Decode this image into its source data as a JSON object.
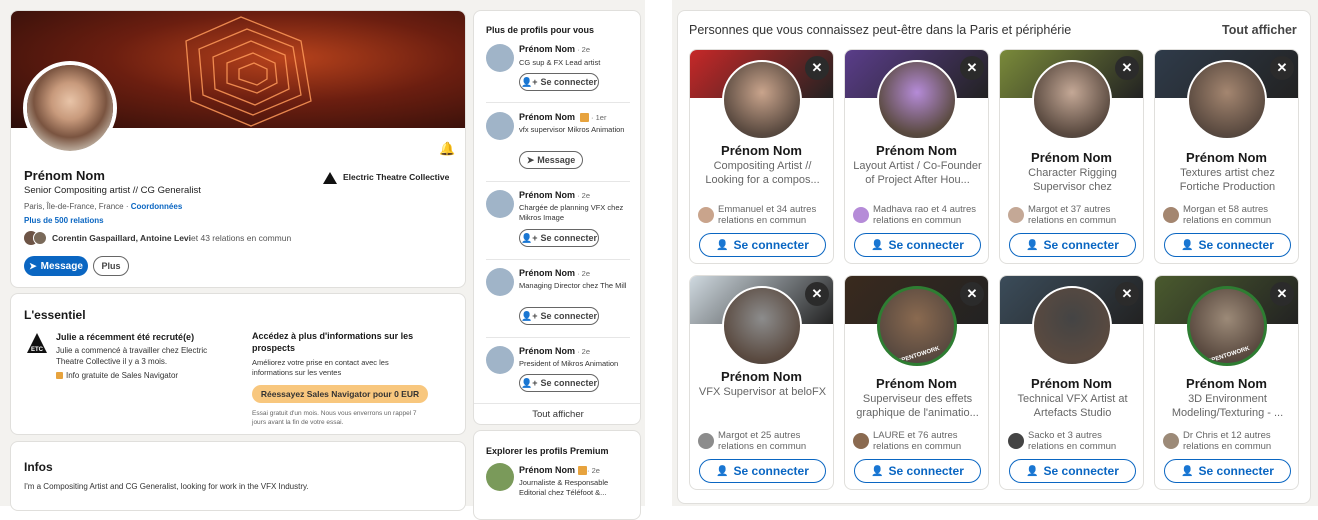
{
  "profile": {
    "name": "Prénom Nom",
    "headline": "Senior Compositing artist // CG Generalist",
    "location": "Paris, Île-de-France, France",
    "location_sep": " · ",
    "contact_link": "Coordonnées",
    "connections": "Plus de 500 relations",
    "mutual_names": "Corentin Gaspaillard, Antoine Levi",
    "mutual_rest": " et 43 relations en commun",
    "company": "Electric Theatre Collective",
    "company_logo": "ETC",
    "message_btn": "Message",
    "more_btn": "Plus"
  },
  "essentials": {
    "title": "L'essentiel",
    "hired_title": "Julie a récemment été recruté(e)",
    "hired_desc": "Julie a commencé à travailler chez Electric Theatre Collective il y a 3 mois.",
    "sales_info": "Info gratuite de Sales Navigator",
    "access_title": "Accédez à plus d'informations sur les prospects",
    "access_desc": "Améliorez votre prise en contact avec les informations sur les ventes",
    "retry_btn": "Réessayez Sales Navigator pour 0 EUR",
    "trial_note": "Essai gratuit d'un mois. Nous vous enverrons un rappel 7 jours avant la fin de votre essai."
  },
  "about": {
    "title": "Infos",
    "text": "I'm a Compositing Artist and CG Generalist, looking for work in the VFX Industry."
  },
  "more_profiles": {
    "title": "Plus de profils pour vous",
    "items": [
      {
        "name": "Prénom Nom",
        "degree": " · 2e",
        "headline": "CG sup & FX Lead artist",
        "btn": "Se connecter",
        "linkedin_badge": false
      },
      {
        "name": "Prénom Nom",
        "degree": " · 1er",
        "headline": "vfx supervisor Mikros Animation",
        "btn": "Message",
        "linkedin_badge": true
      },
      {
        "name": "Prénom Nom",
        "degree": " · 2e",
        "headline": "Chargée de planning VFX chez Mikros Image",
        "btn": "Se connecter",
        "linkedin_badge": false
      },
      {
        "name": "Prénom Nom",
        "degree": " · 2e",
        "headline": "Managing Director chez The Mill",
        "btn": "Se connecter",
        "linkedin_badge": false
      },
      {
        "name": "Prénom Nom",
        "degree": " · 2e",
        "headline": "President of Mikros Animation",
        "btn": "Se connecter",
        "linkedin_badge": false
      }
    ],
    "show_all": "Tout afficher"
  },
  "premium": {
    "title": "Explorer les profils Premium",
    "name": "Prénom Nom",
    "degree": " · 2e",
    "headline": "Journaliste & Responsable Editorial chez Téléfoot &..."
  },
  "pymk": {
    "title": "Personnes que vous connaissez peut-être dans la Paris et périphérie",
    "show_all": "Tout afficher",
    "connect_label": "Se connecter",
    "close_glyph": "✕",
    "cards": [
      {
        "name": "Prénom Nom",
        "headline": "Compositing Artist // Looking for a compos...",
        "mutual": "Emmanuel et 34 autres relations en commun",
        "cover": "#c62828",
        "avatar": "#c9a48c"
      },
      {
        "name": "Prénom Nom",
        "headline": "Layout Artist / Co-Founder of Project After Hou...",
        "mutual": "Madhava rao et 4 autres relations en commun",
        "cover": "#5a3d8a",
        "avatar": "#b58bd8"
      },
      {
        "name": "Prénom Nom",
        "headline": "Character Rigging Supervisor chez Illumination ...",
        "mutual": "Margot et 37 autres relations en commun",
        "cover": "#7a8a3a",
        "avatar": "#c4a896"
      },
      {
        "name": "Prénom Nom",
        "headline": "Textures artist chez Fortiche Production",
        "mutual": "Morgan et 58 autres relations en commun",
        "cover": "#2f3b4a",
        "avatar": "#a48670"
      },
      {
        "name": "Prénom Nom",
        "headline": "VFX Supervisor at beloFX",
        "mutual": "Margot et 25 autres relations en commun",
        "cover": "#cfd9e0",
        "avatar": "#8c8c8c"
      },
      {
        "name": "Prénom Nom",
        "headline": "Superviseur des effets graphique de l'animatio...",
        "mutual": "LAURE et 76 autres relations en commun",
        "cover": "#3a2a1e",
        "avatar": "#8a6a50",
        "badge": "#OPENTOWORK"
      },
      {
        "name": "Prénom Nom",
        "headline": "Technical VFX Artist at Artefacts Studio",
        "mutual": "Sacko et 3 autres relations en commun",
        "cover": "#3b4c5a",
        "avatar": "#444444"
      },
      {
        "name": "Prénom Nom",
        "headline": "3D Environment Modeling/Texturing - ...",
        "mutual": "Dr Chris et 12 autres relations en commun",
        "cover": "#4a5a2e",
        "avatar": "#9c8a78",
        "badge": "#OPENTOWORK"
      }
    ]
  },
  "colors": {
    "accent": "#0a66c2",
    "gold": "#f8c77e",
    "linkedin_badge": "#e7a33e",
    "opentowork": "#2e7d32"
  }
}
